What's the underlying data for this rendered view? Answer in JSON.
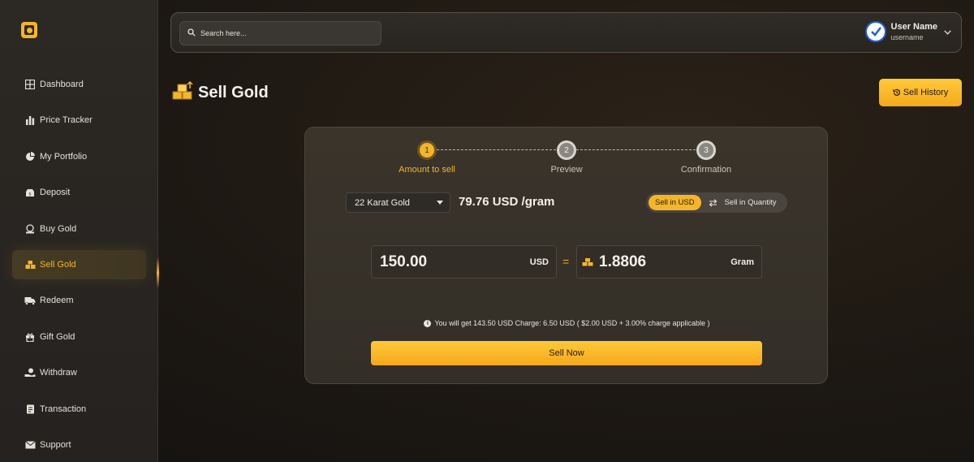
{
  "sidebar": {
    "items": [
      {
        "label": "Dashboard",
        "icon": "grid-icon"
      },
      {
        "label": "Price Tracker",
        "icon": "bar-chart-icon"
      },
      {
        "label": "My Portfolio",
        "icon": "pie-chart-icon"
      },
      {
        "label": "Deposit",
        "icon": "wallet-icon"
      },
      {
        "label": "Buy Gold",
        "icon": "coin-hand-icon"
      },
      {
        "label": "Sell Gold",
        "icon": "gold-bars-icon",
        "active": true
      },
      {
        "label": "Redeem",
        "icon": "truck-icon"
      },
      {
        "label": "Gift Gold",
        "icon": "gift-icon"
      },
      {
        "label": "Withdraw",
        "icon": "withdraw-icon"
      },
      {
        "label": "Transaction",
        "icon": "receipt-icon"
      },
      {
        "label": "Support",
        "icon": "mail-icon"
      }
    ]
  },
  "header": {
    "search_placeholder": "Search here...",
    "user_name": "User Name",
    "username": "username"
  },
  "page": {
    "title": "Sell Gold",
    "history_button": "Sell History"
  },
  "steps": [
    {
      "number": "1",
      "label": "Amount to sell",
      "state": "active"
    },
    {
      "number": "2",
      "label": "Preview",
      "state": "inactive"
    },
    {
      "number": "3",
      "label": "Confirmation",
      "state": "inactive"
    }
  ],
  "form": {
    "karat": "22 Karat Gold",
    "price": "79.76 USD /gram",
    "toggle_usd": "Sell in USD",
    "toggle_qty": "Sell in Quantity",
    "amount_value": "150.00",
    "amount_unit": "USD",
    "equals": "=",
    "gram_value": "1.8806",
    "gram_unit": "Gram",
    "info_text": "You will get 143.50 USD Charge: 6.50 USD ( $2.00 USD + 3.00% charge applicable )",
    "sell_button": "Sell Now"
  },
  "colors": {
    "accent": "#f5b52a",
    "background": "#1d1813",
    "sidebar": "#2c2823",
    "card": "#3a342b"
  }
}
